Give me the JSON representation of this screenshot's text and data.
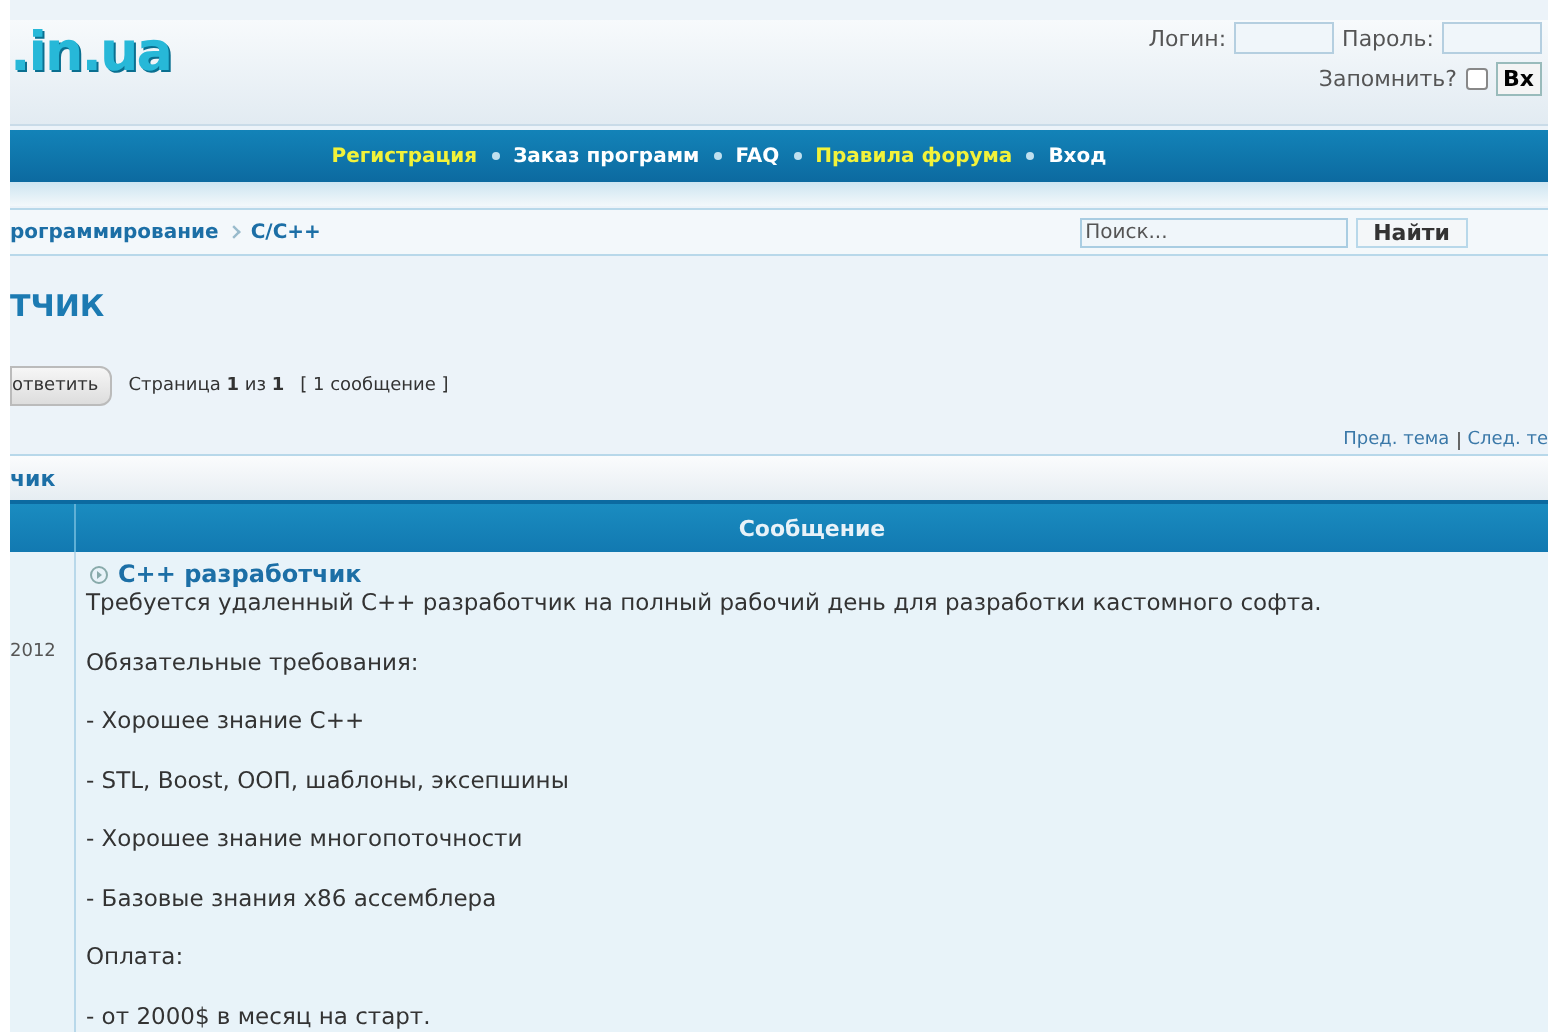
{
  "logo": ".in.ua",
  "login": {
    "login_label": "Логин:",
    "password_label": "Пароль:",
    "remember_label": "Запомнить?",
    "remember_checked": false,
    "submit": "Вх"
  },
  "nav": [
    {
      "label": "Регистрация",
      "highlighted": true
    },
    {
      "label": "Заказ программ",
      "highlighted": false
    },
    {
      "label": "FAQ",
      "highlighted": false
    },
    {
      "label": "Правила форума",
      "highlighted": true
    },
    {
      "label": "Вход",
      "highlighted": false
    }
  ],
  "breadcrumbs": [
    "рограммирование",
    "C/C++"
  ],
  "search": {
    "placeholder": "Поиск...",
    "button": "Найти"
  },
  "topic_title": "ТЧИК",
  "reply_button": "ответить",
  "pagination": "Страница **1** из **1**",
  "post_count": "[ 1 сообщение ]",
  "topic_nav": [
    "Пред. тема",
    "След. те"
  ],
  "topic_header": "чик",
  "table": {
    "columns": [
      "Сообщение"
    ]
  },
  "post": {
    "date": "2012",
    "title": "C++ разработчик",
    "lines": [
      "Требуется удаленный C++ разработчик на полный рабочий день для разработки кастомного софта.",
      "Обязательные требования:",
      "- Хорошее знание C++",
      "- STL, Boost, ООП, шаблоны, эксепшины",
      "- Хорошее знание многопоточности",
      "- Базовые знания x86 ассемблера",
      "Оплата:",
      "- от 2000$ в месяц на старт."
    ]
  }
}
